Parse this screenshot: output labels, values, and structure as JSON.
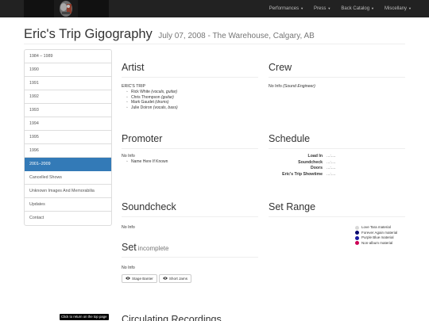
{
  "navbar": {
    "menu": [
      {
        "label": "Performances"
      },
      {
        "label": "Press"
      },
      {
        "label": "Back Catalog"
      },
      {
        "label": "Miscellany"
      }
    ]
  },
  "page": {
    "title": "Eric's Trip Gigography",
    "subtitle": "July 07, 2008 - The Warehouse, Calgary, AB"
  },
  "sidebar": {
    "items": [
      {
        "label": "1984 – 1989"
      },
      {
        "label": "1990"
      },
      {
        "label": "1991"
      },
      {
        "label": "1992"
      },
      {
        "label": "1993"
      },
      {
        "label": "1994"
      },
      {
        "label": "1995"
      },
      {
        "label": "1996"
      },
      {
        "label": "2001–2009"
      },
      {
        "label": "Cancelled Shows"
      },
      {
        "label": "Unknown Images And Memorabilia"
      },
      {
        "label": "Updates"
      },
      {
        "label": "Contact"
      }
    ]
  },
  "artist": {
    "heading": "Artist",
    "name": "ERIC'S TRIP",
    "members": [
      {
        "name": "Rick White",
        "role": "(vocals, guitar)"
      },
      {
        "name": "Chris Thompson",
        "role": "(guitar)"
      },
      {
        "name": "Mark Gaudet",
        "role": "(drums)"
      },
      {
        "name": "Julie Doiron",
        "role": "(vocals, bass)"
      }
    ]
  },
  "crew": {
    "heading": "Crew",
    "text": "No Info",
    "role": "(Sound Engineer)"
  },
  "promoter": {
    "heading": "Promoter",
    "text": "No Info",
    "item": "Name Here If Known"
  },
  "schedule": {
    "heading": "Schedule",
    "rows": [
      {
        "label": "Load In",
        "value": "...:...."
      },
      {
        "label": "Soundcheck",
        "value": "...:...."
      },
      {
        "label": "Doors",
        "value": "...:...."
      },
      {
        "label": "Eric's Trip Showtime",
        "value": "...:...."
      }
    ]
  },
  "soundcheck": {
    "heading": "Soundcheck",
    "text": "No Info"
  },
  "set_range": {
    "heading": "Set Range",
    "legend": [
      {
        "label": "Love Tara material",
        "color": "#d8d8d8"
      },
      {
        "label": "Forever Again material",
        "color": "#0a0a6e"
      },
      {
        "label": "Purple Blue material",
        "color": "#1a1aa0"
      },
      {
        "label": "Non-album material",
        "color": "#cc0055"
      }
    ]
  },
  "set": {
    "heading": "Set",
    "status": "incomplete",
    "text": "No Info",
    "buttons": [
      {
        "label": "Stage Banter"
      },
      {
        "label": "Short Jams"
      }
    ]
  },
  "circulating": {
    "heading": "Circulating Recordings"
  },
  "tooltip": {
    "text": "Click to return on the top page"
  }
}
